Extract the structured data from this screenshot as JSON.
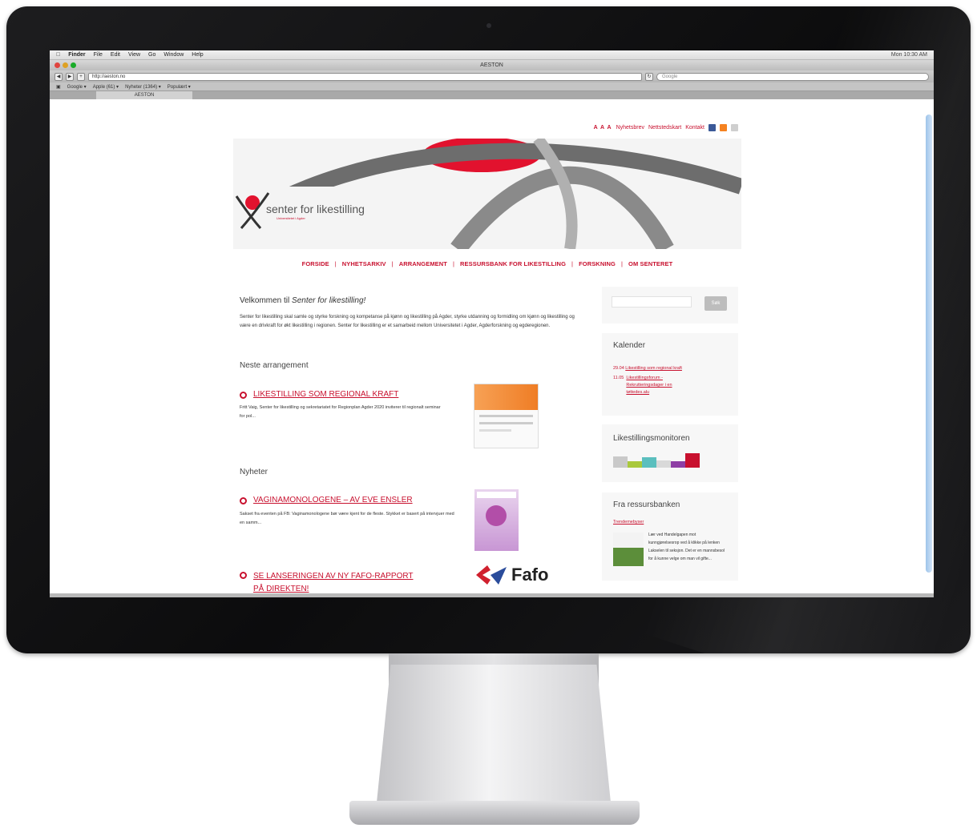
{
  "menubar": {
    "apple": "",
    "items": [
      "Finder",
      "File",
      "Edit",
      "View",
      "Go",
      "Window",
      "Help"
    ],
    "clock": "Mon 10:30 AM"
  },
  "browser": {
    "window_title": "AESTON",
    "url": "http://aeston.no",
    "search_placeholder": "Google",
    "bookmarks": [
      "Google ▾",
      "Apple (61) ▾",
      "Nyheter (1364) ▾",
      "Populært ▾"
    ],
    "tab_title": "AESTON"
  },
  "site": {
    "text_size": "A A A",
    "top_links": [
      "Nyhetsbrev",
      "Nettstedskart",
      "Kontakt"
    ],
    "logo_text": "senter for likestilling",
    "logo_tagline": "Universitetet i Agder",
    "nav": [
      "FORSIDE",
      "NYHETSARKIV",
      "ARRANGEMENT",
      "RESSURSBANK FOR LIKESTILLING",
      "FORSKNING",
      "OM SENTERET"
    ],
    "welcome_prefix": "Velkommen til",
    "welcome_name": "Senter for likestilling!",
    "intro": "Senter for likestilling skal samle og styrke forskning og kompetanse på kjønn og likestilling på Agder, styrke utdanning og formidling om kjønn og likestilling og være en drivkraft for økt likestilling i regionen. Senter for likestilling er et samarbeid mellom Universitetet i Agder, Agderforskning og egderegionen.",
    "next_event_heading": "Neste arrangement",
    "next_event": {
      "title": "LIKESTILLING SOM REGIONAL KRAFT",
      "text": "Fritt Vaig, Senter for likestilling og sekretariatet for Regionplan Agder 2020 inviterer til regionalt seminar for pol..."
    },
    "news_heading": "Nyheter",
    "news": [
      {
        "title": "VAGINAMONOLOGENE – AV EVE ENSLER",
        "text": "Sakset fra eventen på FB: Vaginamonologene bør være kjent for de fleste. Stykket er basert på intervjuer med en samm..."
      },
      {
        "title_line1": "SE LANSERINGEN AV NY FAFO-RAPPORT",
        "title_line2": "PÅ DIREKTEN!",
        "image_text": "Fafo"
      }
    ],
    "sidebar": {
      "search_button": "Søk",
      "calendar_title": "Kalender",
      "calendar": [
        {
          "date": "29.04",
          "text": "Likestilling som regional kraft"
        },
        {
          "date": "11.05",
          "text": "Likestillingsforum - Rekrutteringsdager i en tøttedes.alu"
        }
      ],
      "monitor_title": "Likestillingsmonitoren",
      "resource_title": "Fra ressursbanken",
      "resource_link": "Trendemebyser",
      "resource_text": "Lær ved Handelgapen mot kunngjørelsesrop ved å klikke på lenken Lakselen til seksjon. Det er en mannsbesol for å kunne velge om man vil gifte..."
    }
  },
  "colors": {
    "accent": "#c8102e",
    "bezel": "#111113"
  }
}
